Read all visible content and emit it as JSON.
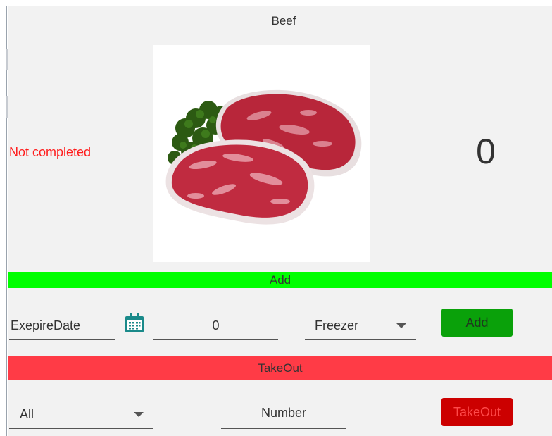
{
  "item": {
    "title": "Beef",
    "status": "Not completed",
    "count": "0",
    "image_icon": "beef-steak-image"
  },
  "add_section": {
    "header": "Add",
    "expire_date_placeholder": "ExepireDate",
    "calendar_icon": "calendar-icon",
    "quantity_value": "0",
    "location_selected": "Freezer",
    "add_button": "Add"
  },
  "takeout_section": {
    "header": "TakeOut",
    "filter_selected": "All",
    "number_placeholder": "Number",
    "takeout_button": "TakeOut"
  },
  "colors": {
    "panel_bg": "#f2f2f2",
    "status_red": "#ff1c1c",
    "add_bar": "#00ff00",
    "add_button": "#0aa10a",
    "takeout_bar": "#ff3b46",
    "takeout_button": "#cc0000"
  }
}
